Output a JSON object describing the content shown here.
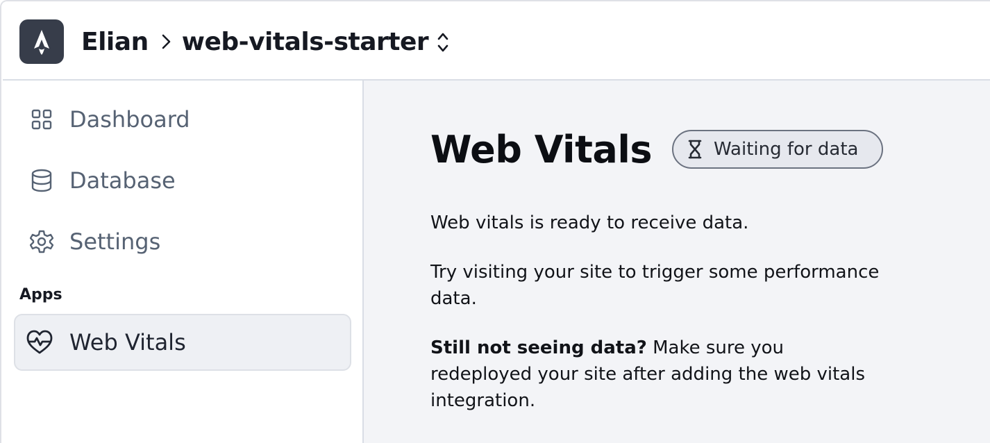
{
  "header": {
    "org": "Elian",
    "project": "web-vitals-starter",
    "logo_icon": "astro-logo-icon",
    "switcher_icon": "chevron-up-down-icon"
  },
  "sidebar": {
    "items": [
      {
        "label": "Dashboard",
        "icon": "grid-icon"
      },
      {
        "label": "Database",
        "icon": "database-icon"
      },
      {
        "label": "Settings",
        "icon": "gear-icon"
      }
    ],
    "apps_heading": "Apps",
    "apps": [
      {
        "label": "Web Vitals",
        "icon": "heart-pulse-icon",
        "active": true
      }
    ]
  },
  "main": {
    "title": "Web Vitals",
    "status_badge": "Waiting for data",
    "status_icon": "hourglass-icon",
    "paragraphs": {
      "ready": "Web vitals is ready to receive data.",
      "try": "Try visiting your site to trigger some performance data.",
      "still_bold": "Still not seeing data?",
      "still_rest": " Make sure you redeployed your site after adding the web vitals integration."
    }
  },
  "colors": {
    "logo_bg": "#373d4a",
    "nav_text": "#566273",
    "main_bg": "#f3f4f7",
    "active_bg": "#eef0f4"
  }
}
